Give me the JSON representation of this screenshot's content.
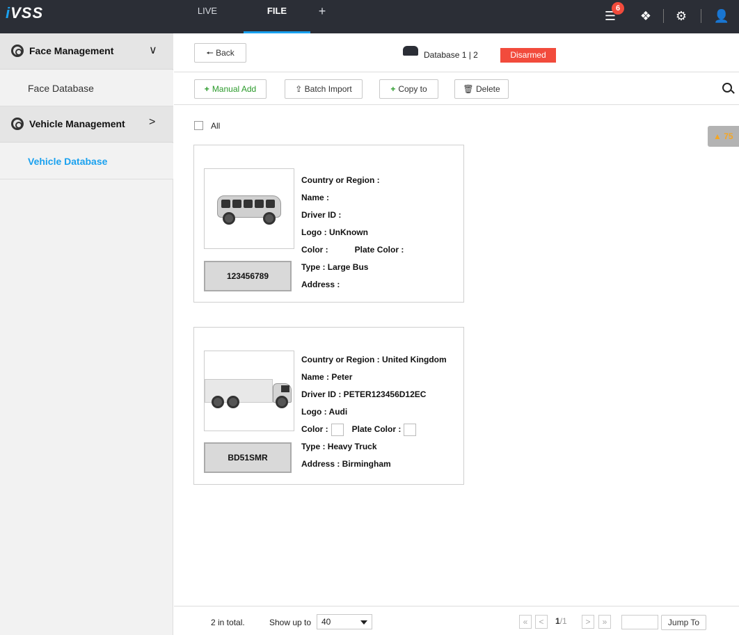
{
  "app": {
    "logo_prefix": "i",
    "logo_name": "VSS"
  },
  "topbar": {
    "tabs": [
      {
        "label": "LIVE"
      },
      {
        "label": "FILE"
      },
      {
        "label": "+"
      }
    ],
    "notification_count": "6"
  },
  "sidebar": {
    "face_management": {
      "label": "Face Management",
      "chevron": "∨",
      "item": "Face Database"
    },
    "vehicle_management": {
      "label": "Vehicle Management",
      "chevron": ">",
      "item": "Vehicle Database"
    }
  },
  "header": {
    "back_label": "Back",
    "database_label": "Database 1 | 2",
    "status_label": "Disarmed",
    "status_color": "#f24b3c"
  },
  "toolbar": {
    "manual_add": "Manual Add",
    "batch_import": "Batch Import",
    "copy_to": "Copy to",
    "delete": "Delete"
  },
  "select_all_label": "All",
  "alert_text": "75",
  "vehicles": [
    {
      "plate": "123456789",
      "country": "Country or Region :",
      "name": "Name :",
      "driver_id": "Driver ID :",
      "logo": "Logo : UnKnown",
      "color": "Color :",
      "plate_color": "Plate Color :",
      "type": "Type : Large Bus",
      "address": "Address :"
    },
    {
      "plate": "BD51SMR",
      "country": "Country or Region : United Kingdom",
      "name": "Name : Peter",
      "driver_id": "Driver ID : PETER123456D12EC",
      "logo": "Logo : Audi",
      "color": "Color :",
      "plate_color": "Plate Color :",
      "type": "Type : Heavy Truck",
      "address": "Address : Birmingham"
    }
  ],
  "footer": {
    "total": "2 in total.",
    "show_up_to": "Show up to",
    "page_size": "40",
    "page_current": "1",
    "page_total": "/1",
    "first": "«",
    "prev": "<",
    "next": ">",
    "last": "»",
    "jump_to": "Jump To"
  },
  "accent_color": "#1aa1ef"
}
